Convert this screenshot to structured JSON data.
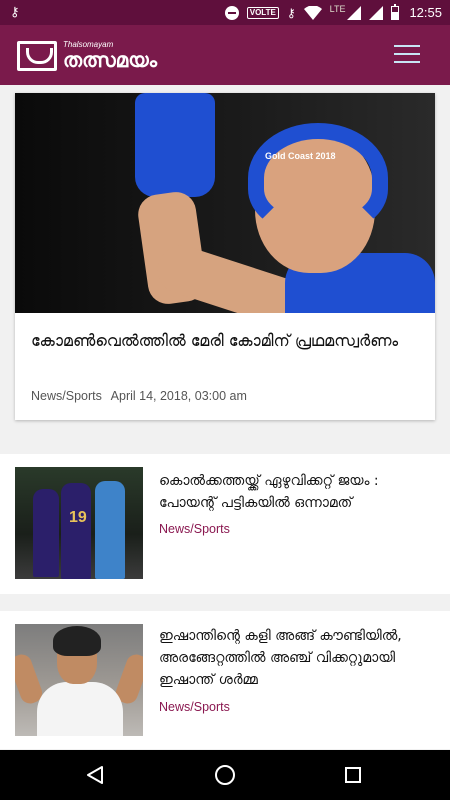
{
  "status_bar": {
    "time": "12:55",
    "volte": "VOLTE",
    "network": "LTE",
    "icons": [
      "key-icon",
      "do-not-disturb-icon",
      "volte-icon",
      "key-icon",
      "wifi-icon",
      "lte-signal-icon",
      "signal-icon",
      "battery-icon"
    ]
  },
  "app_bar": {
    "logo_small": "Thalsomayam",
    "logo_main": "തത്സമയം",
    "colors": {
      "status": "#5f0f3c",
      "bar": "#7a1a4b",
      "accent": "#8a1850"
    }
  },
  "featured_article": {
    "title": "കോമൺവെൽത്തിൽ മേരി കോമിന് പ്രഥമസ്വർണം",
    "category": "News/Sports",
    "date": "April 14, 2018, 03:00 am",
    "image_label": "Gold Coast 2018"
  },
  "articles": [
    {
      "title": "കൊൽക്കത്തയ്ക്ക് ഏഴുവിക്കറ്റ് ജയം : പോയന്റ് പട്ടികയിൽ ഒന്നാമത്",
      "category": "News/Sports",
      "jersey_number": "19"
    },
    {
      "title": "ഇഷാന്തിന്റെ കളി അങ്ങ് കൗണ്ടിയിൽ, അരങ്ങേറ്റത്തിൽ അഞ്ച് വിക്കറ്റുമായി ഇഷാന്ത് ശർമ്മ",
      "category": "News/Sports"
    }
  ],
  "nav_bar": {
    "icons": [
      "back-icon",
      "home-icon",
      "recents-icon"
    ]
  }
}
